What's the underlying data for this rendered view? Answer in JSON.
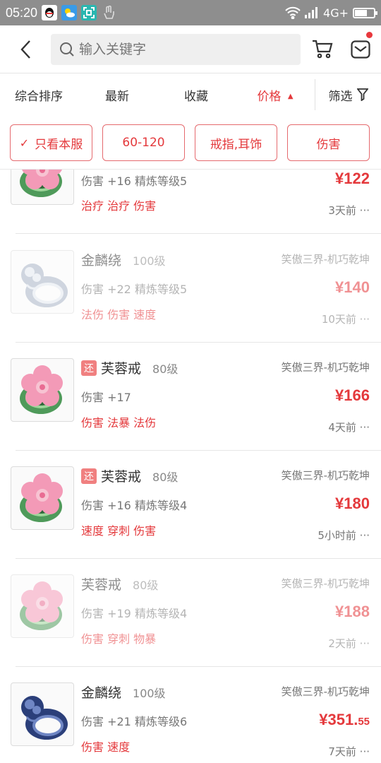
{
  "status": {
    "time": "05:20",
    "network": "4G+",
    "battery_level": 0.65
  },
  "search": {
    "placeholder": "输入关键字"
  },
  "sort": {
    "items": [
      "综合排序",
      "最新",
      "收藏",
      "价格"
    ],
    "price_arrow": "▲",
    "filter_label": "筛选"
  },
  "chips": [
    {
      "label": "只看本服",
      "checked": true
    },
    {
      "label": "60-120"
    },
    {
      "label": "戒指,耳饰"
    },
    {
      "label": "伤害"
    }
  ],
  "items": [
    {
      "name": "",
      "level": "",
      "server": "",
      "stats": "伤害 +16 精炼等级5",
      "attrs": "治疗 治疗 伤害",
      "price": "¥122",
      "price_dec": "",
      "ago": "3天前 ···",
      "tag": "",
      "ring": "jade",
      "dim": false
    },
    {
      "name": "金麟绕",
      "level": "100级",
      "server": "笑傲三界-机巧乾坤",
      "stats": "伤害 +22 精炼等级5",
      "attrs": "法伤 伤害 速度",
      "price": "¥140",
      "price_dec": "",
      "ago": "10天前 ···",
      "tag": "",
      "ring": "silver",
      "dim": true
    },
    {
      "name": "芙蓉戒",
      "level": "80级",
      "server": "笑傲三界-机巧乾坤",
      "stats": "伤害 +17",
      "attrs": "伤害 法暴 法伤",
      "price": "¥166",
      "price_dec": "",
      "ago": "4天前 ···",
      "tag": "还",
      "ring": "jade",
      "dim": false
    },
    {
      "name": "芙蓉戒",
      "level": "80级",
      "server": "笑傲三界-机巧乾坤",
      "stats": "伤害 +16 精炼等级4",
      "attrs": "速度 穿刺 伤害",
      "price": "¥180",
      "price_dec": "",
      "ago": "5小时前 ···",
      "tag": "还",
      "ring": "jade",
      "dim": false
    },
    {
      "name": "芙蓉戒",
      "level": "80级",
      "server": "笑傲三界-机巧乾坤",
      "stats": "伤害 +19 精炼等级4",
      "attrs": "伤害 穿刺 物暴",
      "price": "¥188",
      "price_dec": "",
      "ago": "2天前 ···",
      "tag": "",
      "ring": "jade",
      "dim": true
    },
    {
      "name": "金麟绕",
      "level": "100级",
      "server": "笑傲三界-机巧乾坤",
      "stats": "伤害 +21 精炼等级6",
      "attrs": "伤害 速度",
      "price": "¥351.",
      "price_dec": "55",
      "ago": "7天前 ···",
      "tag": "",
      "ring": "blue",
      "dim": false
    }
  ],
  "colors": {
    "accent": "#e4393c",
    "status_bar": "#8e8e8e"
  }
}
